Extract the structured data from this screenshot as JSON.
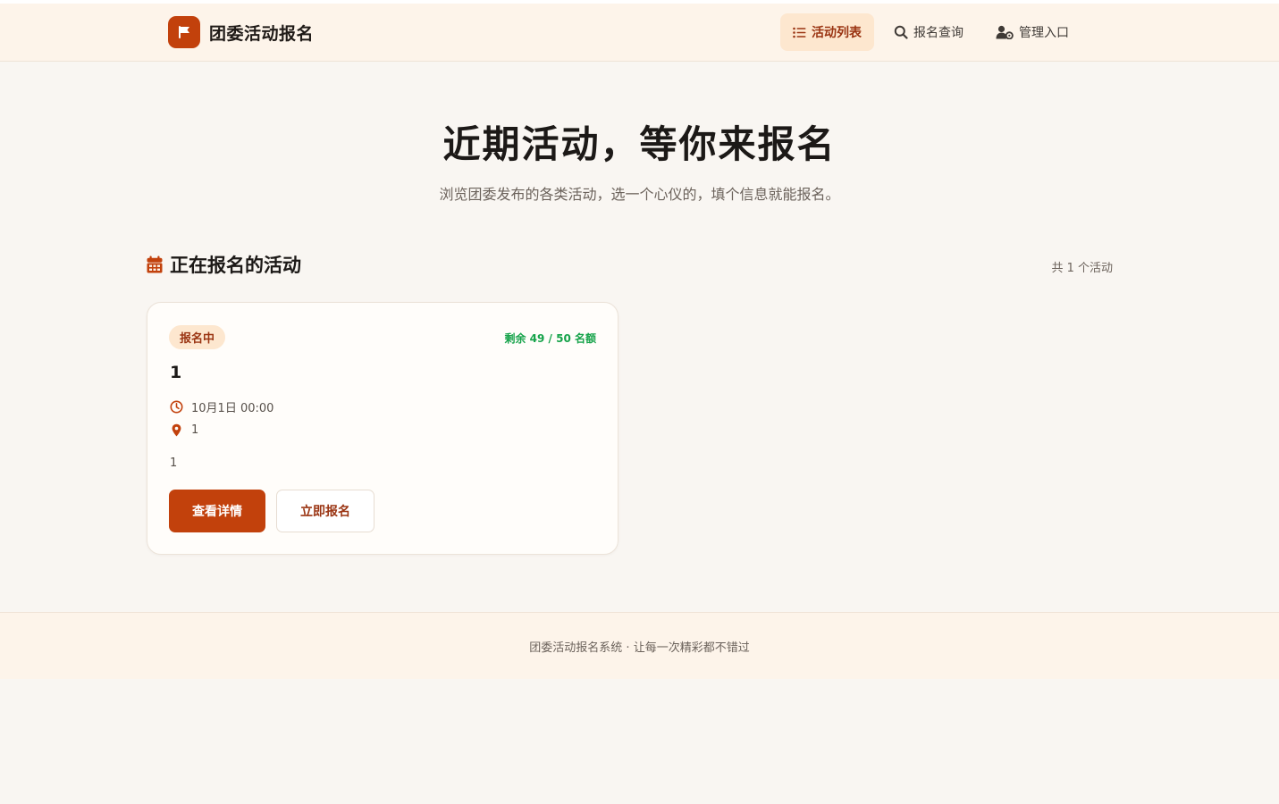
{
  "header": {
    "brand_name": "团委活动报名",
    "nav": [
      {
        "label": "活动列表",
        "icon": "list-icon",
        "active": true
      },
      {
        "label": "报名查询",
        "icon": "search-icon",
        "active": false
      },
      {
        "label": "管理入口",
        "icon": "user-gear-icon",
        "active": false
      }
    ]
  },
  "hero": {
    "title": "近期活动，等你来报名",
    "subtitle": "浏览团委发布的各类活动，选一个心仪的，填个信息就能报名。"
  },
  "section": {
    "title": "正在报名的活动",
    "count": "共 1 个活动"
  },
  "activities": [
    {
      "status": "报名中",
      "quota": "剩余 49 / 50 名额",
      "title": "1",
      "time": "10月1日 00:00",
      "location": "1",
      "description": "1",
      "detail_button": "查看详情",
      "signup_button": "立即报名"
    }
  ],
  "footer": {
    "text": "团委活动报名系统 · 让每一次精彩都不错过"
  },
  "colors": {
    "accent": "#c2410c",
    "accent_dark": "#9a3412",
    "quota_green": "#16a34a",
    "background": "#f9f6f2",
    "header_bg": "#fdf4ea"
  }
}
